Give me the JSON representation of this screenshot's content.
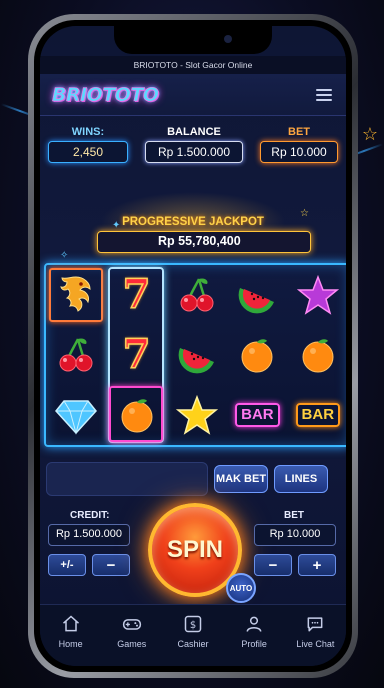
{
  "browser": {
    "page_title": "BRIOTOTO - Slot Gacor Online"
  },
  "header": {
    "logo_text": "BRIOTOTO",
    "menu_icon": "hamburger-menu-icon"
  },
  "stats": {
    "wins_label": "WINS:",
    "wins_value": "2,450",
    "balance_label": "BALANCE",
    "balance_value": "Rp 1.500.000",
    "bet_label": "BET",
    "bet_value": "Rp 10.000"
  },
  "jackpot": {
    "title": "PROGRESSIVE JACKPOT",
    "value": "Rp 55,780,400"
  },
  "reels": [
    [
      "dragon",
      "seven",
      "cherry",
      "watermelon",
      "star-purple"
    ],
    [
      "cherry",
      "seven",
      "watermelon",
      "orange",
      "orange"
    ],
    [
      "diamond",
      "orange",
      "star-gold",
      "BAR",
      "BAR"
    ]
  ],
  "controls": {
    "max_bet_label": "MAK BET",
    "lines_label": "LINES",
    "credit_label": "CREDIT:",
    "credit_value": "Rp 1.500.000",
    "bet_label": "BET",
    "bet_value": "Rp 10.000",
    "plus_minus_label": "+/-",
    "minus_label": "−",
    "plus_label": "+",
    "spin_label": "SPIN",
    "auto_label": "AUTO"
  },
  "nav": [
    {
      "label": "Home",
      "icon": "home-icon"
    },
    {
      "label": "Games",
      "icon": "gamepad-icon"
    },
    {
      "label": "Cashier",
      "icon": "cashier-icon"
    },
    {
      "label": "Profile",
      "icon": "profile-icon"
    },
    {
      "label": "Live Chat",
      "icon": "chat-icon"
    }
  ],
  "colors": {
    "accent_blue": "#3ab8ff",
    "accent_gold": "#ffc43a",
    "spin_red": "#f0401a"
  }
}
